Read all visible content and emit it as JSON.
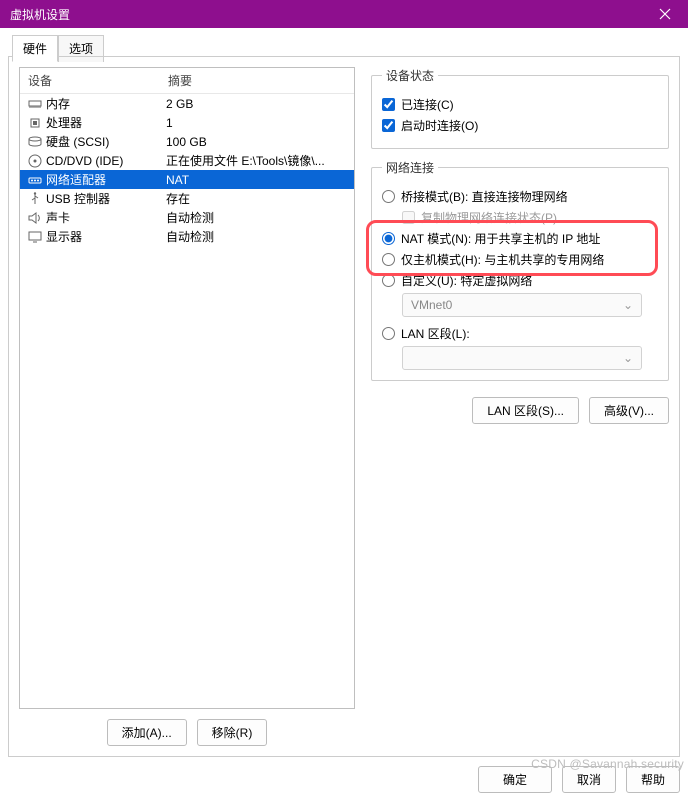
{
  "window": {
    "title": "虚拟机设置"
  },
  "tabs": {
    "hardware": "硬件",
    "options": "选项"
  },
  "hw_header": {
    "device": "设备",
    "summary": "摘要"
  },
  "hw": [
    {
      "icon": "memory-icon",
      "name": "内存",
      "summary": "2 GB"
    },
    {
      "icon": "cpu-icon",
      "name": "处理器",
      "summary": "1"
    },
    {
      "icon": "disk-icon",
      "name": "硬盘 (SCSI)",
      "summary": "100 GB"
    },
    {
      "icon": "cd-icon",
      "name": "CD/DVD (IDE)",
      "summary": "正在使用文件 E:\\Tools\\镜像\\..."
    },
    {
      "icon": "network-icon",
      "name": "网络适配器",
      "summary": "NAT",
      "selected": true
    },
    {
      "icon": "usb-icon",
      "name": "USB 控制器",
      "summary": "存在"
    },
    {
      "icon": "sound-icon",
      "name": "声卡",
      "summary": "自动检测"
    },
    {
      "icon": "display-icon",
      "name": "显示器",
      "summary": "自动检测"
    }
  ],
  "buttons": {
    "add": "添加(A)...",
    "remove": "移除(R)",
    "lan_segments": "LAN 区段(S)...",
    "advanced": "高级(V)...",
    "ok": "确定",
    "cancel": "取消",
    "help": "帮助"
  },
  "device_state": {
    "legend": "设备状态",
    "connected": "已连接(C)",
    "connect_at_power_on": "启动时连接(O)"
  },
  "net": {
    "legend": "网络连接",
    "bridged": "桥接模式(B): 直接连接物理网络",
    "replicate": "复制物理网络连接状态(P)",
    "nat": "NAT 模式(N): 用于共享主机的 IP 地址",
    "hostonly": "仅主机模式(H): 与主机共享的专用网络",
    "custom": "自定义(U): 特定虚拟网络",
    "custom_value": "VMnet0",
    "lan": "LAN 区段(L):",
    "lan_value": ""
  },
  "watermark": "CSDN @Savannah.security"
}
